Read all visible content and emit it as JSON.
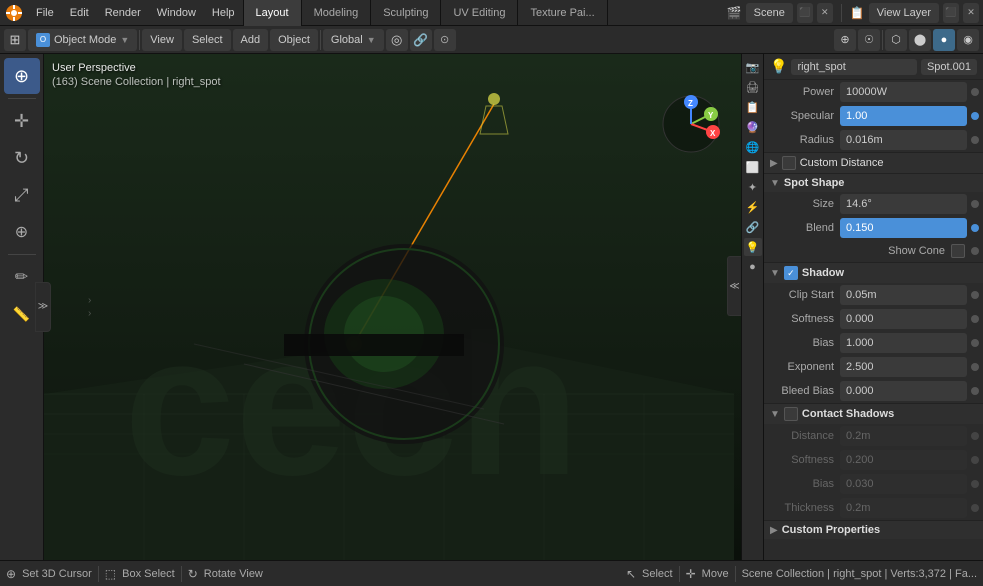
{
  "topMenu": {
    "menuItems": [
      "File",
      "Edit",
      "Render",
      "Window",
      "Help"
    ],
    "workspaceTabs": [
      {
        "label": "Layout",
        "active": true
      },
      {
        "label": "Modeling",
        "active": false
      },
      {
        "label": "Sculpting",
        "active": false
      },
      {
        "label": "UV Editing",
        "active": false
      },
      {
        "label": "Texture Pai...",
        "active": false
      }
    ],
    "sceneLabel": "Scene",
    "viewLayerLabel": "View Layer",
    "icons": {
      "expand1": "⊞",
      "expand2": "⊟",
      "scene_icon": "🎬",
      "viewlayer_icon": "📷"
    }
  },
  "toolbar": {
    "objectMode": "Object Mode",
    "view": "View",
    "select": "Select",
    "add": "Add",
    "object": "Object",
    "global": "Global",
    "transformIcons": [
      "↔",
      "⊕",
      "⊗"
    ]
  },
  "viewport": {
    "perspLabel": "User Perspective",
    "sceneInfo": "(163) Scene Collection | right_spot",
    "axisColors": {
      "x": "#ff4444",
      "y": "#88cc44",
      "z": "#4488ff"
    }
  },
  "leftSidebar": {
    "icons": [
      {
        "name": "cursor",
        "symbol": "⊕",
        "active": true
      },
      {
        "name": "move",
        "symbol": "✛",
        "active": false
      },
      {
        "name": "rotate",
        "symbol": "↻",
        "active": false
      },
      {
        "name": "scale",
        "symbol": "⤢",
        "active": false
      },
      {
        "name": "transform",
        "symbol": "⊕",
        "active": false
      },
      {
        "name": "annotate",
        "symbol": "✏",
        "active": false
      },
      {
        "name": "measure",
        "symbol": "📏",
        "active": false
      }
    ]
  },
  "rightIconBar": {
    "icons": [
      {
        "name": "scene",
        "symbol": "🎬",
        "active": false
      },
      {
        "name": "render",
        "symbol": "📷",
        "active": false
      },
      {
        "name": "output",
        "symbol": "🖨",
        "active": false
      },
      {
        "name": "view_layer",
        "symbol": "📋",
        "active": false
      },
      {
        "name": "scene_props",
        "symbol": "🔮",
        "active": false
      },
      {
        "name": "world",
        "symbol": "🌐",
        "active": false
      },
      {
        "name": "object",
        "symbol": "⬜",
        "active": false
      },
      {
        "name": "particles",
        "symbol": "✨",
        "active": false
      },
      {
        "name": "physics",
        "symbol": "⚡",
        "active": false
      },
      {
        "name": "constraints",
        "symbol": "🔗",
        "active": false
      },
      {
        "name": "data",
        "symbol": "▽",
        "active": false
      },
      {
        "name": "material",
        "symbol": "●",
        "active": false
      }
    ]
  },
  "propertiesPanel": {
    "lightName": "right_spot",
    "lightType": "Spot.001",
    "fields": {
      "power": {
        "label": "Power",
        "value": "10000W"
      },
      "specular": {
        "label": "Specular",
        "value": "1.00",
        "highlight": true
      },
      "radius": {
        "label": "Radius",
        "value": "0.016m"
      }
    },
    "customDistance": {
      "label": "Custom Distance",
      "expanded": false
    },
    "spotShape": {
      "label": "Spot Shape",
      "expanded": true,
      "size": {
        "label": "Size",
        "value": "14.6°"
      },
      "blend": {
        "label": "Blend",
        "value": "0.150",
        "highlight": true
      },
      "showCone": {
        "label": "Show Cone"
      }
    },
    "shadow": {
      "label": "Shadow",
      "expanded": true,
      "enabled": true,
      "clipStart": {
        "label": "Clip Start",
        "value": "0.05m"
      },
      "softness": {
        "label": "Softness",
        "value": "0.000"
      },
      "bias": {
        "label": "Bias",
        "value": "1.000"
      },
      "exponent": {
        "label": "Exponent",
        "value": "2.500"
      },
      "bleedBias": {
        "label": "Bleed Bias",
        "value": "0.000"
      }
    },
    "contactShadows": {
      "label": "Contact Shadows",
      "expanded": true,
      "enabled": false,
      "distance": {
        "label": "Distance",
        "value": "0.2m"
      },
      "softness": {
        "label": "Softness",
        "value": "0.200"
      },
      "bias": {
        "label": "Bias",
        "value": "0.030"
      },
      "thickness": {
        "label": "Thickness",
        "value": "0.2m"
      }
    },
    "customProperties": {
      "label": "Custom Properties",
      "expanded": false
    }
  },
  "statusBar": {
    "cursor": "Set 3D Cursor",
    "boxSelect": "Box Select",
    "rotateView": "Rotate View",
    "select": "Select",
    "move": "Move",
    "sceneInfo": "Scene Collection | right_spot | Verts:3,372 | Fa...",
    "icons": {
      "cursor_icon": "⊕",
      "box_icon": "⬚",
      "rotate_icon": "↻",
      "select_icon": "↖",
      "move_icon": "✛"
    }
  }
}
